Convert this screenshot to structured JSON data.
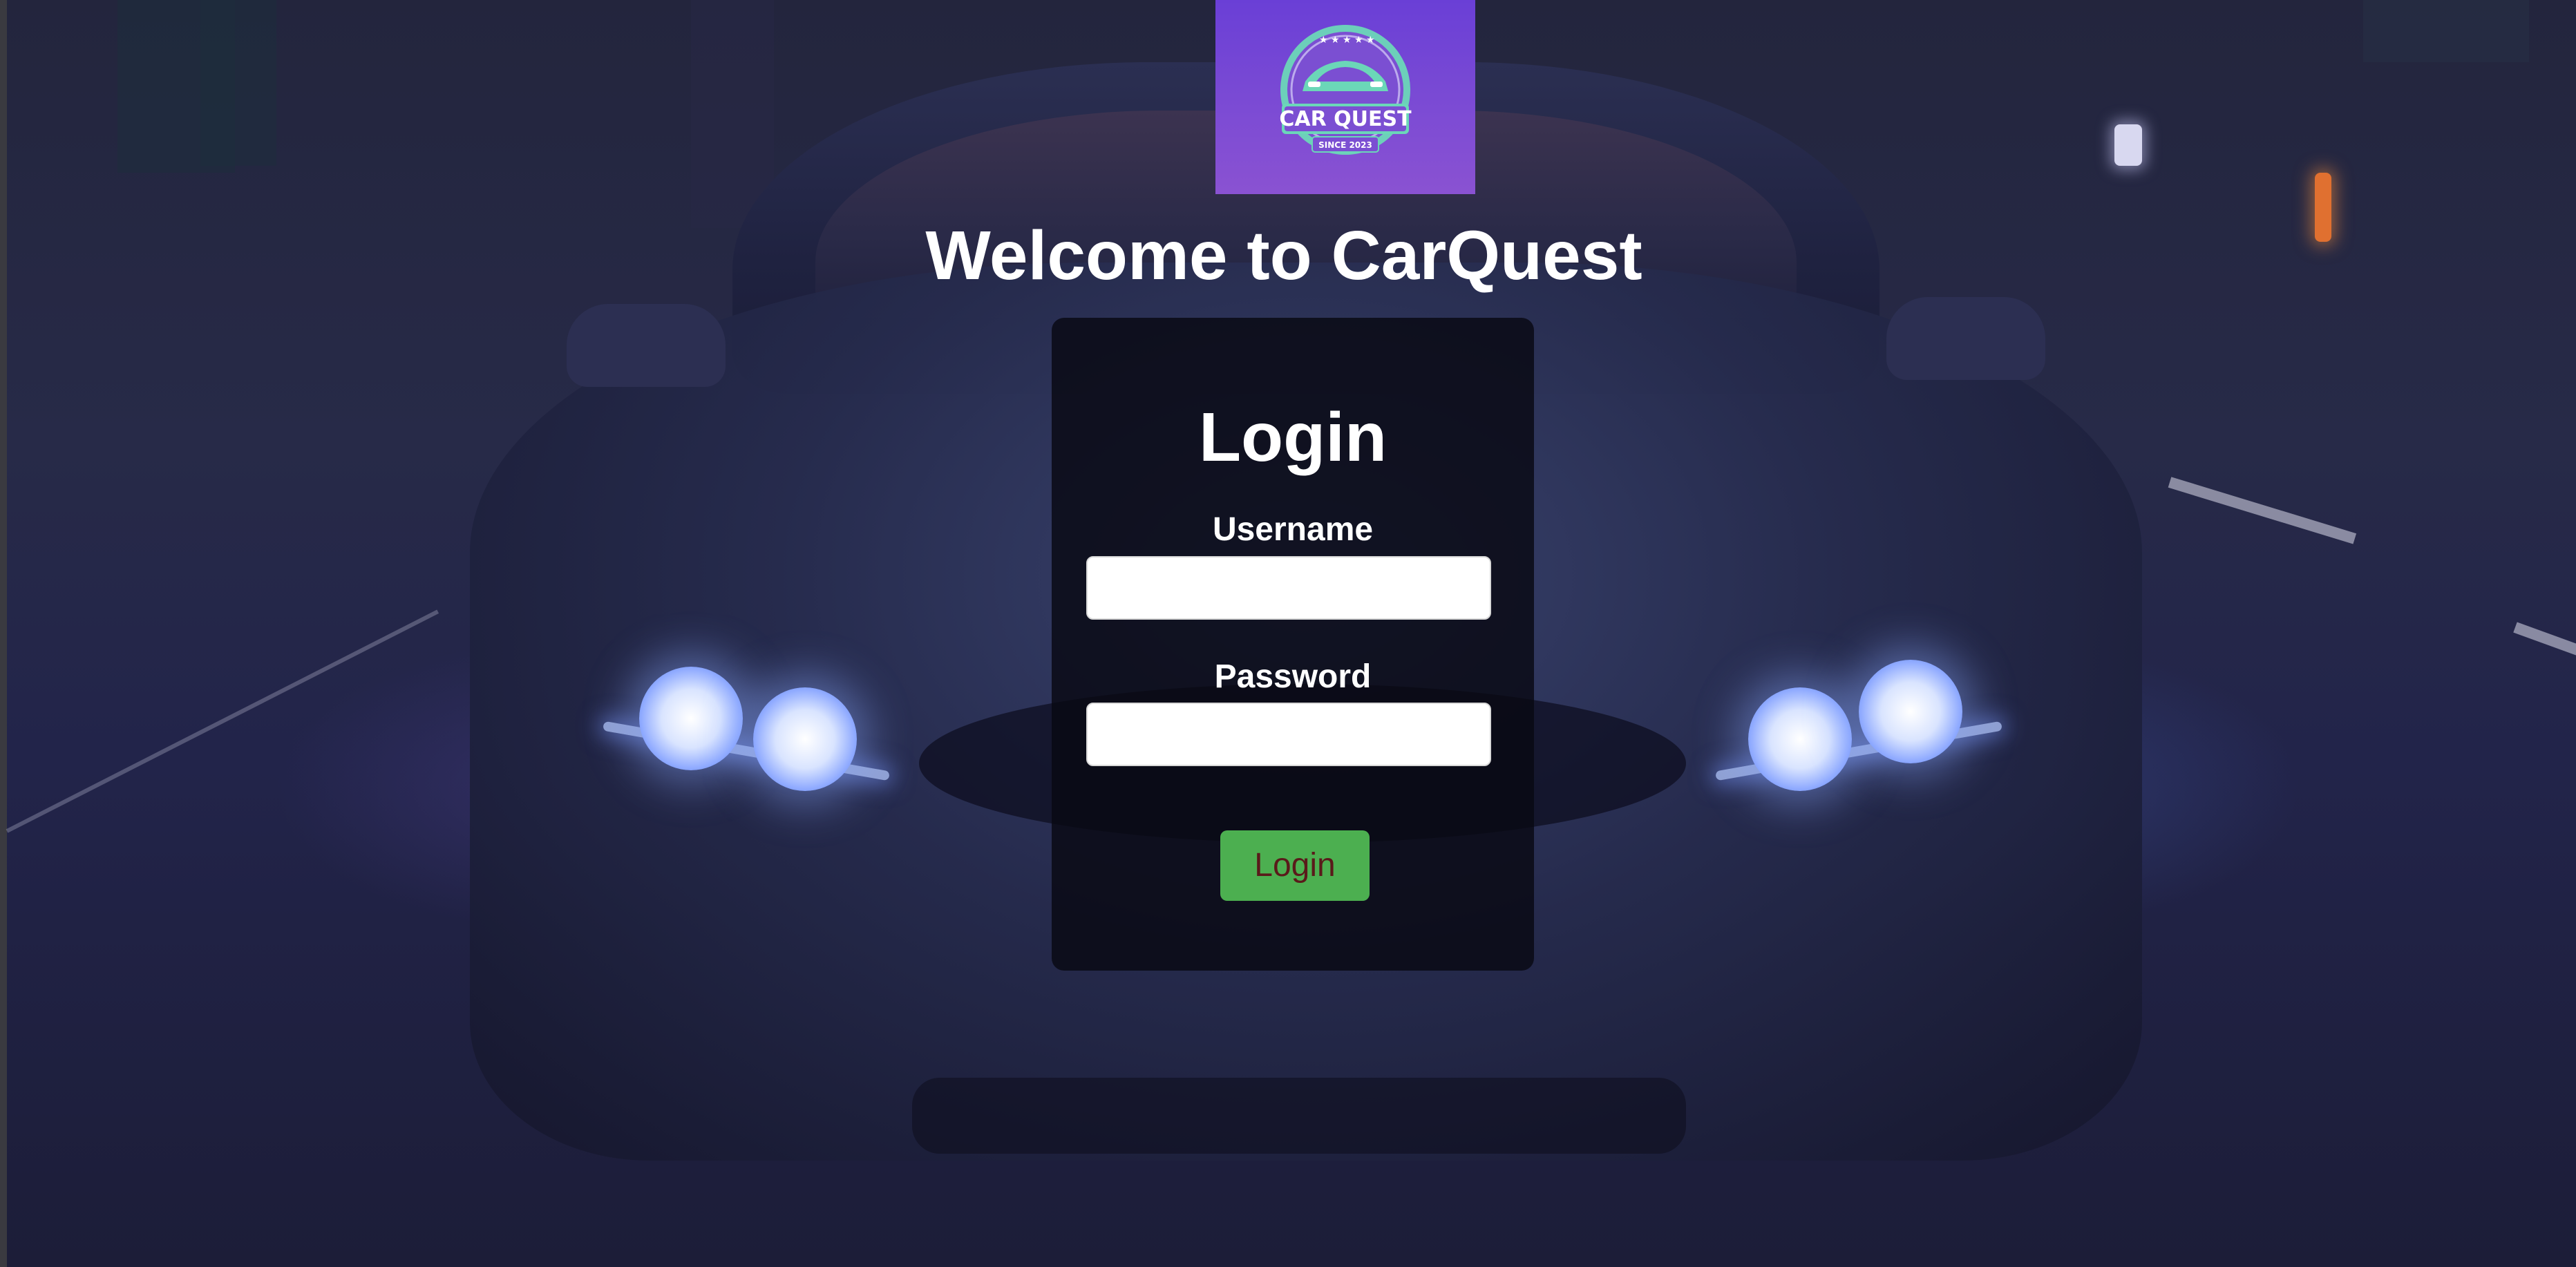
{
  "logo": {
    "brand_text": "CAR QUEST",
    "since_text": "SINCE 2023"
  },
  "header": {
    "welcome_title": "Welcome to CarQuest"
  },
  "login_form": {
    "title": "Login",
    "username_label": "Username",
    "username_value": "",
    "password_label": "Password",
    "password_value": "",
    "submit_label": "Login"
  },
  "colors": {
    "logo_background": "#7a4ad4",
    "button_background": "#4caf50",
    "button_text": "#5a1a1a",
    "card_background": "#08080f"
  }
}
